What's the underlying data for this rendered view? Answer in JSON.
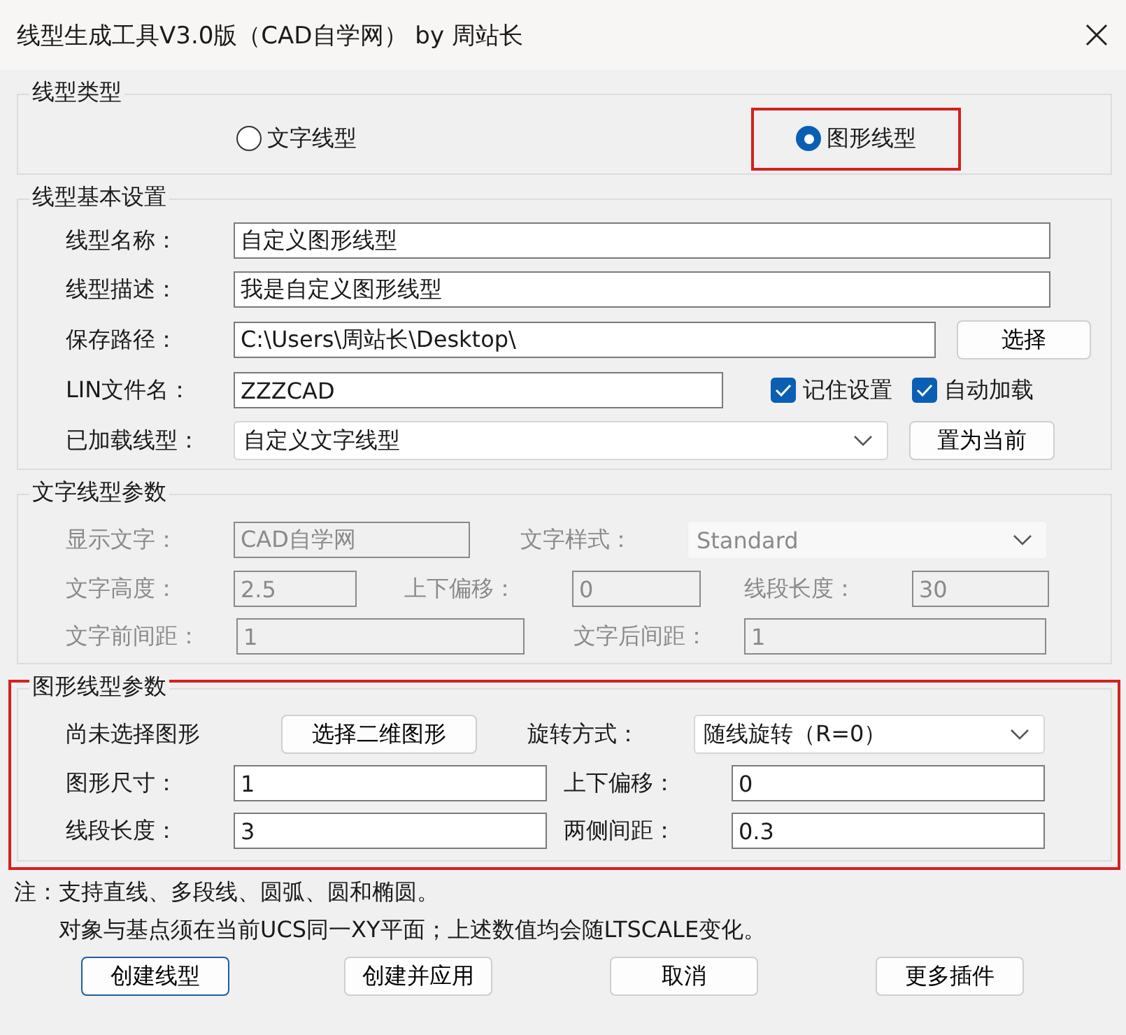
{
  "window": {
    "title": "线型生成工具V3.0版（CAD自学网） by 周站长"
  },
  "linetype_type": {
    "legend": "线型类型",
    "options": [
      {
        "label": "文字线型",
        "selected": false,
        "highlighted": false
      },
      {
        "label": "图形线型",
        "selected": true,
        "highlighted": true
      }
    ]
  },
  "basic": {
    "legend": "线型基本设置",
    "name": {
      "label": "线型名称：",
      "value": "自定义图形线型"
    },
    "description": {
      "label": "线型描述：",
      "value": "我是自定义图形线型"
    },
    "path": {
      "label": "保存路径：",
      "value": "C:\\Users\\周站长\\Desktop\\",
      "button": "选择"
    },
    "lin_file": {
      "label": "LIN文件名：",
      "value": "ZZZCAD"
    },
    "options": [
      {
        "label": "记住设置",
        "checked": true
      },
      {
        "label": "自动加载",
        "checked": true
      }
    ],
    "loaded": {
      "label": "已加载线型：",
      "value": "自定义文字线型",
      "button": "置为当前"
    }
  },
  "text_params": {
    "legend": "文字线型参数",
    "disabled": true,
    "display_text": {
      "label": "显示文字：",
      "value": "CAD自学网"
    },
    "text_style": {
      "label": "文字样式：",
      "value": "Standard"
    },
    "text_height": {
      "label": "文字高度：",
      "value": "2.5"
    },
    "offset": {
      "label": "上下偏移：",
      "value": "0"
    },
    "segment_length": {
      "label": "线段长度：",
      "value": "30"
    },
    "front_gap": {
      "label": "文字前间距：",
      "value": "1"
    },
    "back_gap": {
      "label": "文字后间距：",
      "value": "1"
    }
  },
  "shape_params": {
    "legend": "图形线型参数",
    "highlighted": true,
    "status": "尚未选择图形",
    "select_button": "选择二维图形",
    "rotation": {
      "label": "旋转方式：",
      "value": "随线旋转（R=0）"
    },
    "size": {
      "label": "图形尺寸：",
      "value": "1"
    },
    "offset": {
      "label": "上下偏移：",
      "value": "0"
    },
    "segment_length": {
      "label": "线段长度：",
      "value": "3"
    },
    "side_gap": {
      "label": "两侧间距：",
      "value": "0.3"
    }
  },
  "notes": {
    "prefix": "注：",
    "lines": [
      "支持直线、多段线、圆弧、圆和椭圆。",
      "对象与基点须在当前UCS同一XY平面；上述数值均会随LTSCALE变化。"
    ]
  },
  "buttons": [
    {
      "label": "创建线型",
      "default": true
    },
    {
      "label": "创建并应用",
      "default": false
    },
    {
      "label": "取消",
      "default": false
    },
    {
      "label": "更多插件",
      "default": false
    }
  ]
}
